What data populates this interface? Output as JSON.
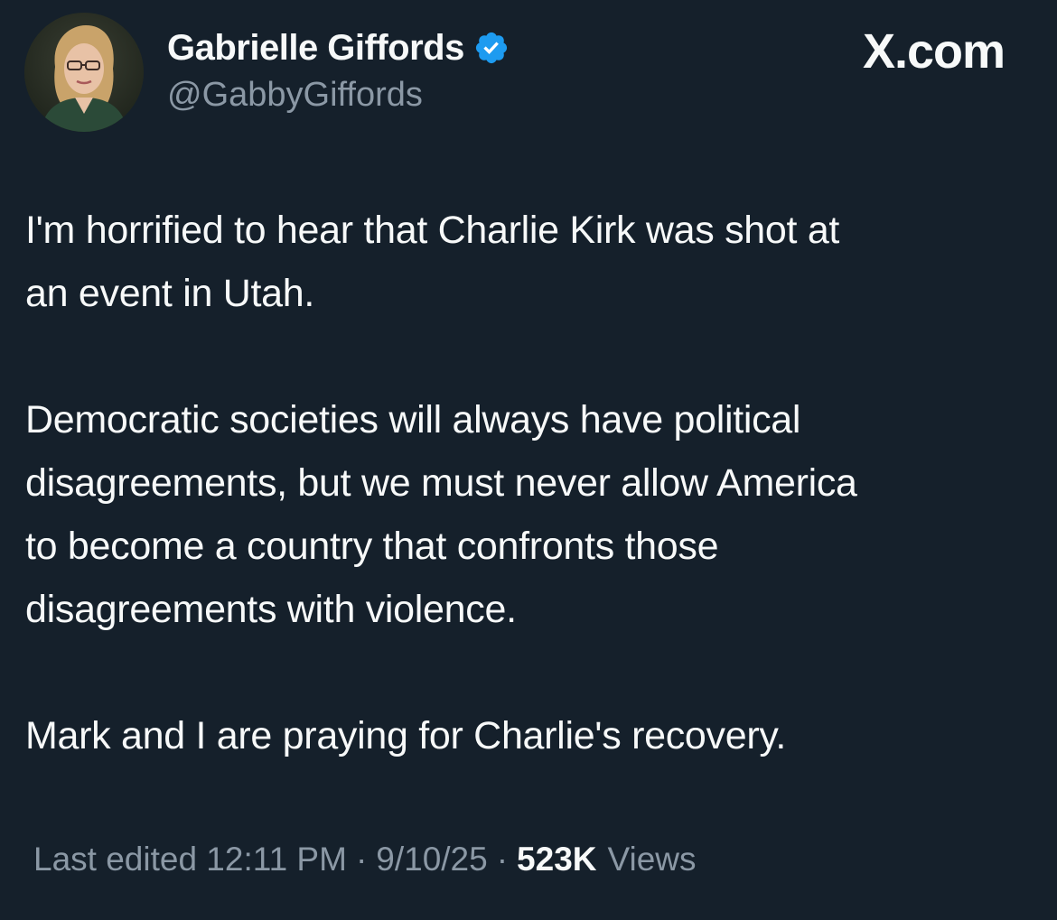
{
  "author": {
    "display_name": "Gabrielle Giffords",
    "handle": "@GabbyGiffords",
    "verified": true
  },
  "site": {
    "label": "X.com"
  },
  "tweet": {
    "paragraphs": [
      "I'm horrified to hear that Charlie Kirk was shot at\nan event in Utah.",
      "Democratic societies will always have political\ndisagreements, but we must never allow America\nto become a country that confronts those\ndisagreements with violence.",
      "Mark and I are praying for Charlie's recovery."
    ]
  },
  "meta": {
    "edited_time": "Last edited 12:11 PM",
    "date": "9/10/25",
    "separator": "·",
    "views_count": "523K",
    "views_label": "Views"
  },
  "colors": {
    "background": "#15202b",
    "text": "#f7f9f9",
    "secondary_text": "#8b98a5",
    "verified_badge": "#1d9bf0"
  },
  "icons": {
    "verified": "verified-badge-icon",
    "avatar": "profile-photo"
  }
}
